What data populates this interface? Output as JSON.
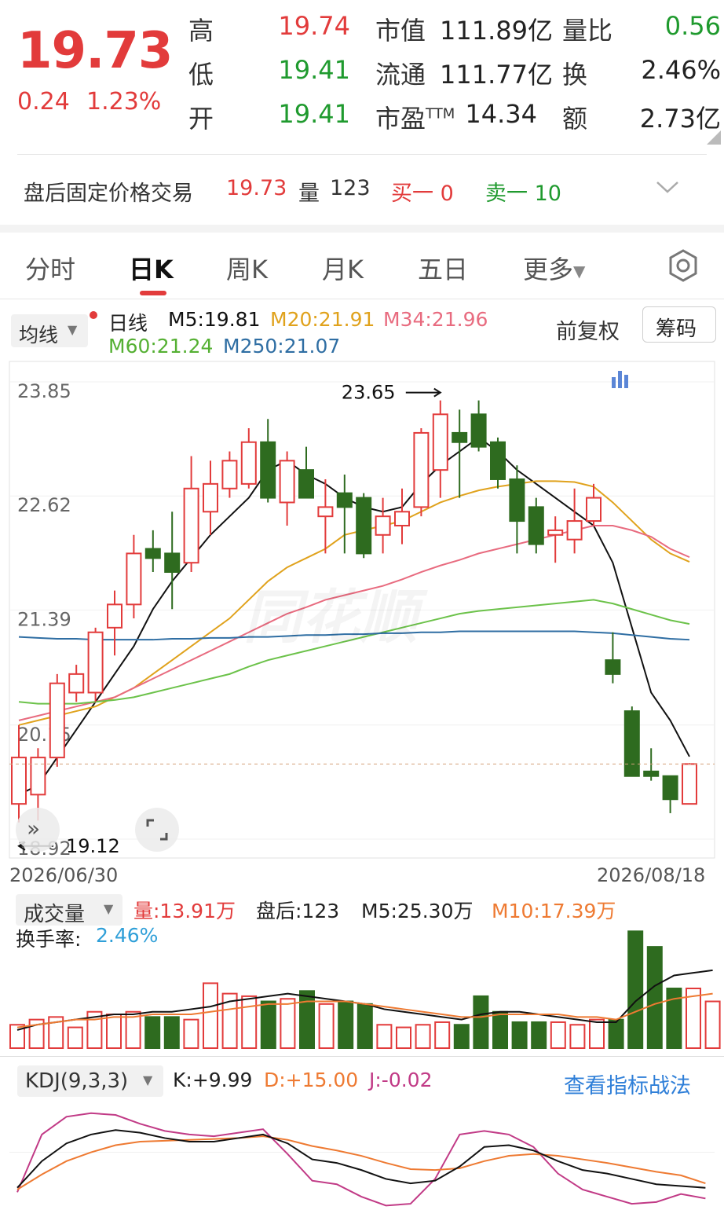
{
  "quote": {
    "price": "19.73",
    "change": "0.24",
    "change_pct": "1.23%",
    "rows": [
      {
        "l1": "高",
        "v1": "19.74",
        "c1": "#e23b3b",
        "l2": "市值",
        "v2": "111.89亿",
        "l3": "量比",
        "v3": "0.56",
        "c3": "#1f9a2e"
      },
      {
        "l1": "低",
        "v1": "19.41",
        "c1": "#1f9a2e",
        "l2": "流通",
        "v2": "111.77亿",
        "l3": "换",
        "v3": "2.46%",
        "c3": "#222"
      },
      {
        "l1": "开",
        "v1": "19.41",
        "c1": "#1f9a2e",
        "l2": "市盈TTM",
        "v2": "14.34",
        "l3": "额",
        "v3": "2.73亿",
        "c3": "#222"
      }
    ]
  },
  "afterhours": {
    "label": "盘后固定价格交易",
    "price": "19.73",
    "vol_label": "量",
    "vol": "123",
    "buy1": "买一 0",
    "sell1": "卖一 10"
  },
  "tabs": [
    "分时",
    "日K",
    "周K",
    "月K",
    "五日",
    "更多"
  ],
  "active_tab": "日K",
  "ma_legend": {
    "selector": "均线",
    "period": "日线",
    "m5": "M5:19.81",
    "m20": "M20:21.91",
    "m34": "M34:21.96",
    "m60": "M60:21.24",
    "m250": "M250:21.07",
    "adjust": "前复权",
    "chip_btn": "筹码"
  },
  "colors": {
    "up": "#e23b3b",
    "down": "#2e6b1f",
    "m5": "#111111",
    "m20": "#e0a21c",
    "m34": "#e86b7f",
    "m60": "#6cc24a",
    "m250": "#2f6ea3",
    "vol_m5": "#111111",
    "vol_m10": "#ee7a32",
    "k": "#111111",
    "d": "#ee7a32",
    "j": "#c13a86"
  },
  "chart_data": {
    "type": "candlestick",
    "y_ticks": [
      "23.85",
      "22.62",
      "21.39",
      "20.15",
      "18.92"
    ],
    "ylim": [
      18.92,
      23.85
    ],
    "x_start": "2026/06/30",
    "x_end": "2026/08/18",
    "high_annotation": "23.65",
    "low_annotation": "19.12",
    "candles": [
      [
        19.3,
        19.8,
        20.15,
        19.1
      ],
      [
        19.4,
        19.8,
        19.9,
        19.12
      ],
      [
        19.8,
        20.6,
        20.7,
        19.7
      ],
      [
        20.5,
        20.7,
        20.8,
        20.4
      ],
      [
        20.5,
        21.15,
        21.2,
        20.4
      ],
      [
        21.2,
        21.45,
        21.6,
        20.9
      ],
      [
        21.45,
        22.0,
        22.2,
        21.3
      ],
      [
        22.05,
        21.95,
        22.25,
        21.8
      ],
      [
        22.0,
        21.8,
        22.45,
        21.4
      ],
      [
        21.9,
        22.7,
        23.05,
        21.8
      ],
      [
        22.45,
        22.75,
        23.0,
        22.2
      ],
      [
        22.7,
        23.0,
        23.1,
        22.6
      ],
      [
        22.75,
        23.2,
        23.35,
        22.7
      ],
      [
        23.2,
        22.6,
        23.45,
        22.55
      ],
      [
        22.55,
        23.0,
        23.1,
        22.3
      ],
      [
        22.9,
        22.6,
        23.15,
        22.6
      ],
      [
        22.4,
        22.5,
        22.8,
        22.0
      ],
      [
        22.65,
        22.5,
        22.85,
        22.0
      ],
      [
        22.6,
        22.0,
        22.65,
        21.95
      ],
      [
        22.2,
        22.4,
        22.6,
        22.0
      ],
      [
        22.3,
        22.45,
        22.7,
        22.1
      ],
      [
        22.5,
        23.3,
        23.35,
        22.4
      ],
      [
        22.9,
        23.5,
        23.65,
        22.6
      ],
      [
        23.3,
        23.2,
        23.55,
        22.6
      ],
      [
        23.5,
        23.15,
        23.65,
        23.1
      ],
      [
        23.2,
        22.8,
        23.25,
        22.7
      ],
      [
        22.8,
        22.35,
        22.95,
        22.0
      ],
      [
        22.5,
        22.1,
        22.6,
        22.0
      ],
      [
        22.2,
        22.25,
        22.4,
        21.9
      ],
      [
        22.15,
        22.35,
        22.7,
        22.0
      ],
      [
        22.35,
        22.6,
        22.75,
        22.3
      ],
      [
        20.85,
        20.7,
        21.15,
        20.6
      ],
      [
        20.3,
        19.6,
        20.35,
        19.6
      ],
      [
        19.65,
        19.6,
        19.9,
        19.55
      ],
      [
        19.6,
        19.35,
        19.6,
        19.2
      ],
      [
        19.3,
        19.73,
        19.74,
        19.3
      ]
    ],
    "ma_lines": {
      "M5": [
        19.4,
        19.5,
        19.8,
        20.1,
        20.4,
        20.7,
        21.0,
        21.4,
        21.7,
        21.95,
        22.2,
        22.4,
        22.6,
        22.9,
        23.0,
        22.85,
        22.75,
        22.6,
        22.5,
        22.45,
        22.5,
        22.75,
        22.95,
        23.1,
        23.25,
        23.1,
        22.9,
        22.75,
        22.6,
        22.45,
        22.3,
        21.9,
        21.2,
        20.5,
        20.2,
        19.81
      ],
      "M20": [
        20.15,
        20.2,
        20.25,
        20.3,
        20.35,
        20.45,
        20.55,
        20.7,
        20.85,
        21.0,
        21.15,
        21.3,
        21.5,
        21.7,
        21.85,
        21.95,
        22.05,
        22.2,
        22.25,
        22.3,
        22.35,
        22.45,
        22.55,
        22.62,
        22.68,
        22.72,
        22.75,
        22.78,
        22.78,
        22.77,
        22.72,
        22.55,
        22.35,
        22.15,
        22.0,
        21.91
      ],
      "M34": [
        20.2,
        20.25,
        20.3,
        20.35,
        20.4,
        20.45,
        20.55,
        20.65,
        20.75,
        20.85,
        20.95,
        21.05,
        21.15,
        21.25,
        21.35,
        21.42,
        21.5,
        21.55,
        21.6,
        21.65,
        21.72,
        21.8,
        21.87,
        21.93,
        22.0,
        22.05,
        22.1,
        22.15,
        22.2,
        22.25,
        22.3,
        22.3,
        22.25,
        22.18,
        22.05,
        21.96
      ],
      "M60": [
        20.4,
        20.38,
        20.38,
        20.38,
        20.4,
        20.42,
        20.45,
        20.5,
        20.55,
        20.6,
        20.65,
        20.7,
        20.78,
        20.85,
        20.9,
        20.95,
        21.0,
        21.05,
        21.1,
        21.15,
        21.2,
        21.25,
        21.3,
        21.35,
        21.38,
        21.4,
        21.42,
        21.44,
        21.46,
        21.48,
        21.5,
        21.46,
        21.4,
        21.34,
        21.28,
        21.24
      ],
      "M250": [
        21.1,
        21.09,
        21.08,
        21.08,
        21.07,
        21.07,
        21.07,
        21.07,
        21.08,
        21.08,
        21.09,
        21.09,
        21.1,
        21.1,
        21.11,
        21.12,
        21.12,
        21.13,
        21.13,
        21.14,
        21.14,
        21.15,
        21.15,
        21.16,
        21.16,
        21.16,
        21.16,
        21.16,
        21.16,
        21.16,
        21.15,
        21.14,
        21.12,
        21.1,
        21.08,
        21.07
      ]
    },
    "volume": {
      "legend": {
        "selector": "成交量",
        "vol": "量:13.91万",
        "after": "盘后:123",
        "m5": "M5:25.30万",
        "m10": "M10:17.39万",
        "turnover_label": "换手率:",
        "turnover": "2.46%"
      },
      "bars": [
        9,
        11,
        12,
        8,
        14,
        13,
        14,
        12,
        12,
        11,
        25,
        21,
        20,
        18,
        19,
        22,
        17,
        18,
        17,
        9,
        8,
        9,
        10,
        9,
        20,
        14,
        10,
        10,
        10,
        9,
        11,
        11,
        45,
        39,
        23,
        23,
        18
      ],
      "m5": [
        7,
        9,
        10,
        11,
        12,
        13,
        13,
        14,
        14,
        15,
        16,
        18,
        19,
        20,
        21,
        20,
        19,
        18,
        17,
        15,
        14,
        13,
        12,
        11,
        13,
        14,
        14,
        13,
        12,
        11,
        10,
        10,
        18,
        24,
        28,
        29,
        30
      ],
      "m10": [
        8,
        9,
        10,
        11,
        11,
        12,
        12,
        13,
        13,
        13,
        14,
        15,
        16,
        17,
        17,
        18,
        18,
        18,
        17,
        16,
        15,
        14,
        13,
        12,
        12,
        13,
        13,
        13,
        13,
        12,
        12,
        11,
        14,
        17,
        19,
        20,
        21
      ]
    },
    "kdj": {
      "legend": {
        "selector": "KDJ(9,3,3)",
        "k": "K:+9.99",
        "d": "D:+15.00",
        "j": "J:-0.02",
        "link": "查看指标战法"
      },
      "k": [
        10,
        40,
        60,
        70,
        75,
        72,
        66,
        62,
        62,
        66,
        70,
        60,
        42,
        38,
        30,
        20,
        15,
        18,
        34,
        56,
        58,
        52,
        40,
        30,
        26,
        20,
        14,
        12,
        10
      ],
      "d": [
        8,
        25,
        40,
        50,
        58,
        62,
        63,
        64,
        65,
        66,
        68,
        64,
        57,
        52,
        46,
        38,
        31,
        30,
        32,
        40,
        46,
        48,
        46,
        42,
        38,
        33,
        28,
        24,
        15
      ],
      "j": [
        5,
        70,
        90,
        94,
        92,
        82,
        74,
        70,
        68,
        72,
        76,
        48,
        18,
        14,
        0,
        -10,
        -8,
        20,
        70,
        74,
        70,
        56,
        26,
        8,
        0,
        -8,
        -6,
        3,
        -2
      ]
    }
  }
}
